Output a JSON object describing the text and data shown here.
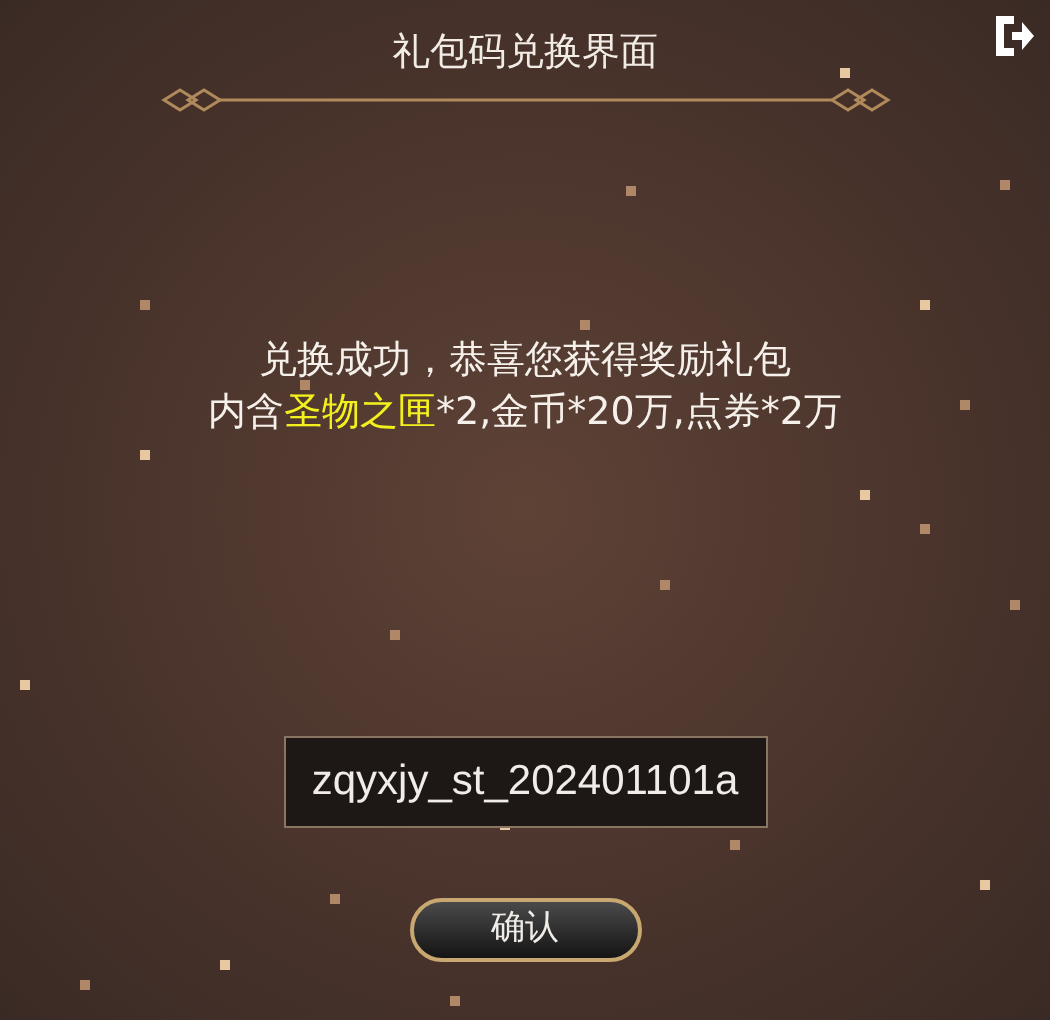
{
  "title": "礼包码兑换界面",
  "message": {
    "line_1": "兑换成功，恭喜您获得奖励礼包",
    "line_2": [
      {
        "text": "内含",
        "highlight": false
      },
      {
        "text": "圣物之匣",
        "highlight": true
      },
      {
        "text": "*2,金币*20万,点券*2万",
        "highlight": false
      }
    ]
  },
  "code_field": {
    "value": "zqyxjy_st_202401101a"
  },
  "confirm_button": {
    "label": "确认"
  }
}
